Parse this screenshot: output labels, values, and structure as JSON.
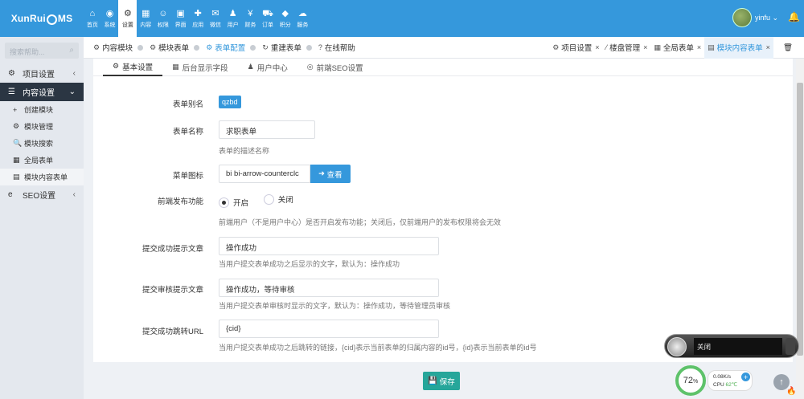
{
  "brand": {
    "logo_left": "XunRui",
    "logo_right": "MS"
  },
  "nav": [
    {
      "icon": "⌂",
      "label": "首页"
    },
    {
      "icon": "◉",
      "label": "系统"
    },
    {
      "icon": "⚙",
      "label": "设置"
    },
    {
      "icon": "▦",
      "label": "内容"
    },
    {
      "icon": "☺",
      "label": "权限"
    },
    {
      "icon": "▣",
      "label": "界面"
    },
    {
      "icon": "✚",
      "label": "应用"
    },
    {
      "icon": "✉",
      "label": "微信"
    },
    {
      "icon": "♟",
      "label": "用户"
    },
    {
      "icon": "¥",
      "label": "财务"
    },
    {
      "icon": "⛟",
      "label": "订单"
    },
    {
      "icon": "◆",
      "label": "积分"
    },
    {
      "icon": "☁",
      "label": "服务"
    }
  ],
  "user": {
    "name": "yinfu",
    "caret": "⌄",
    "bell": "🔔"
  },
  "sidebar": {
    "search_placeholder": "搜索帮助...",
    "items": [
      {
        "icon": "⚙",
        "label": "项目设置",
        "arrow": "‹"
      },
      {
        "icon": "☰",
        "label": "内容设置",
        "arrow": "⌄"
      }
    ],
    "sub": [
      {
        "icon": "+",
        "label": "创建模块"
      },
      {
        "icon": "⚙",
        "label": "模块管理"
      },
      {
        "icon": "🔍",
        "label": "模块搜索"
      },
      {
        "icon": "▦",
        "label": "全局表单"
      },
      {
        "icon": "▤",
        "label": "模块内容表单"
      }
    ],
    "seo": {
      "icon": "e",
      "label": "SEO设置",
      "arrow": "‹"
    }
  },
  "tabs": [
    {
      "icon": "⚙",
      "label": "内容模块"
    },
    {
      "icon": "⚙",
      "label": "模块表单"
    },
    {
      "icon": "⚙",
      "label": "表单配置"
    },
    {
      "icon": "↻",
      "label": "重建表单"
    },
    {
      "icon": "?",
      "label": "在线帮助"
    }
  ],
  "open_tabs": [
    {
      "icon": "⚙",
      "label": "项目设置",
      "close": "×"
    },
    {
      "icon": "⁄",
      "label": "楼盘管理",
      "close": "×"
    },
    {
      "icon": "▦",
      "label": "全局表单",
      "close": "×"
    },
    {
      "icon": "▤",
      "label": "模块内容表单",
      "close": "×"
    }
  ],
  "trash_icon": "🗑",
  "subtabs": [
    {
      "icon": "⚙",
      "label": "基本设置"
    },
    {
      "icon": "▦",
      "label": "后台显示字段"
    },
    {
      "icon": "♟",
      "label": "用户中心"
    },
    {
      "icon": "◎",
      "label": "前端SEO设置"
    }
  ],
  "form": {
    "alias_label": "表单别名",
    "alias_value": "qzbd",
    "name_label": "表单名称",
    "name_value": "求职表单",
    "name_help": "表单的描述名称",
    "icon_label": "菜单图标",
    "icon_value": "bi bi-arrow-counterclc",
    "view_btn": "查看",
    "view_icon": "➜",
    "publish_label": "前端发布功能",
    "on_label": "开启",
    "off_label": "关闭",
    "publish_help": "前端用户（不是用户中心）是否开启发布功能；关闭后，仅前端用户的发布权限将会无效",
    "success_label": "提交成功提示文章",
    "success_value": "操作成功",
    "success_help": "当用户提交表单成功之后显示的文字，默认为：操作成功",
    "audit_label": "提交审核提示文章",
    "audit_value": "操作成功，等待审核",
    "audit_help": "当用户提交表单审核时显示的文字，默认为：操作成功，等待管理员审核",
    "url_label": "提交成功跳转URL",
    "url_value": "{cid}",
    "url_help": "当用户提交表单成功之后跳转的链接，{cid}表示当前表单的归属内容的id号，{id}表示当前表单的id号"
  },
  "save": {
    "icon": "💾",
    "label": "保存"
  },
  "widget": {
    "text": "关闭"
  },
  "speed": {
    "percent": "72",
    "unit": "%",
    "rate": "0.08K/s",
    "cpu_label": "CPU",
    "cpu_temp": "62℃",
    "plus": "+"
  },
  "totop": "↑",
  "fire": "🔥"
}
